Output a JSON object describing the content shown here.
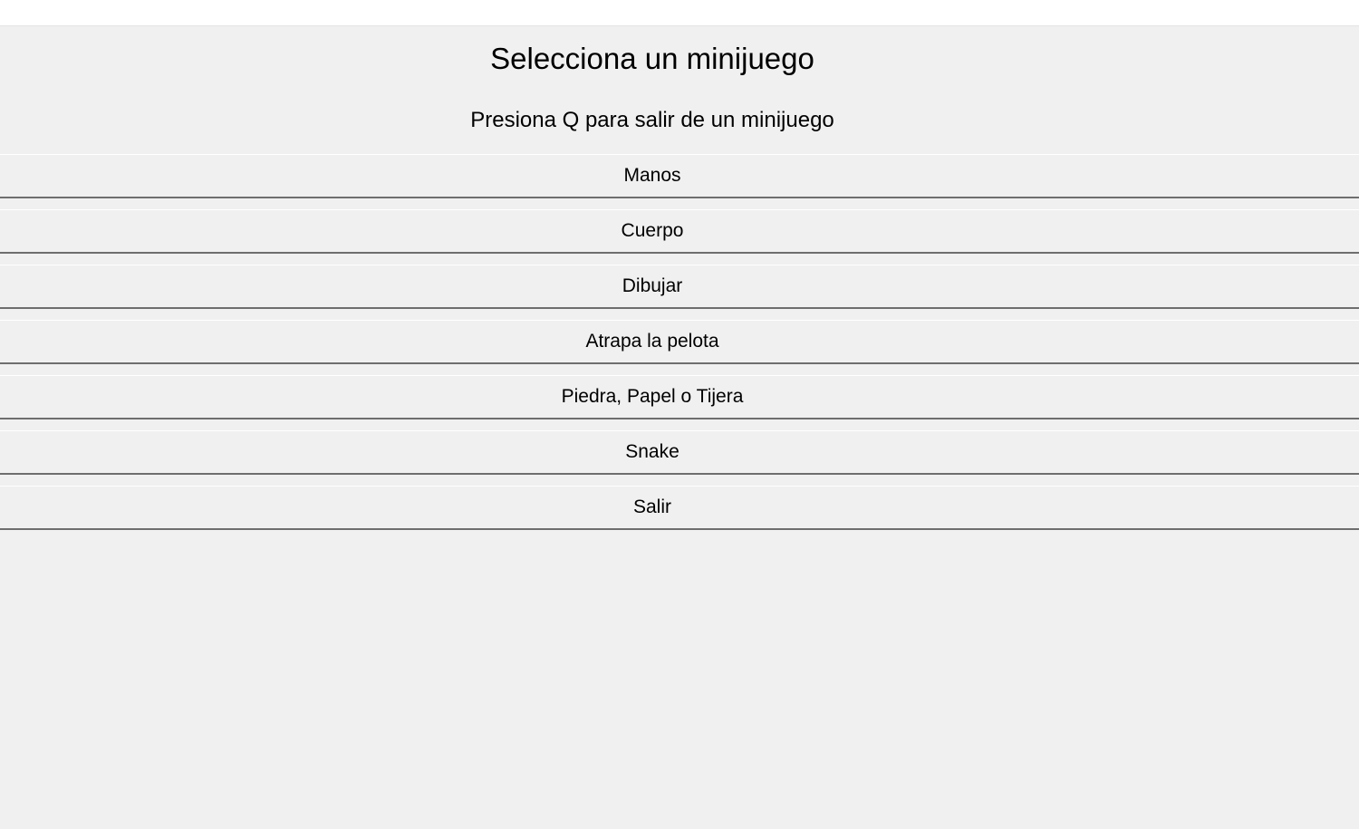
{
  "window": {
    "background": "#f0f0f0"
  },
  "header": {
    "title": "Selecciona un minijuego",
    "subtitle": "Presiona Q para salir de un minijuego"
  },
  "menu": {
    "items": [
      {
        "label": "Manos"
      },
      {
        "label": "Cuerpo"
      },
      {
        "label": "Dibujar"
      },
      {
        "label": "Atrapa la pelota"
      },
      {
        "label": "Piedra, Papel o Tijera"
      },
      {
        "label": "Snake"
      },
      {
        "label": "Salir"
      }
    ]
  }
}
